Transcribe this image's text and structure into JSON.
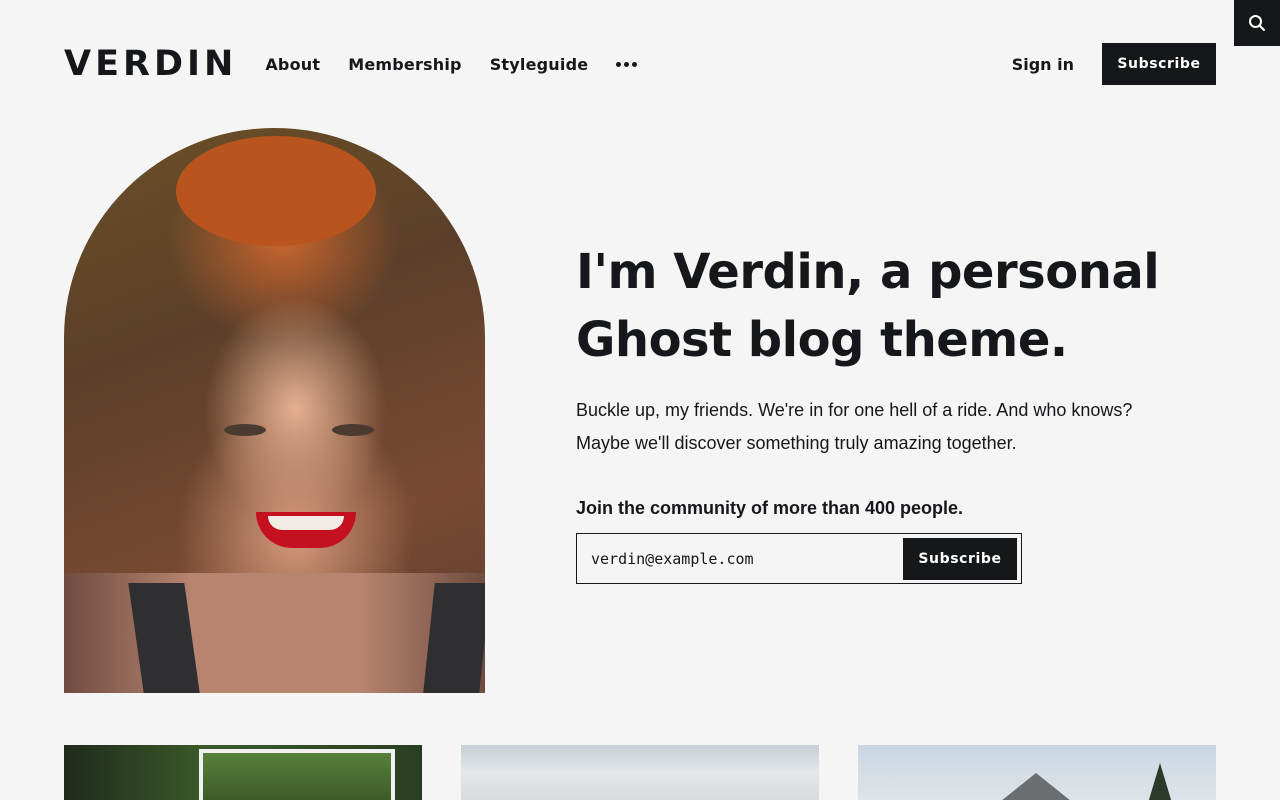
{
  "header": {
    "logo": "VERDIN",
    "nav": [
      {
        "label": "About"
      },
      {
        "label": "Membership"
      },
      {
        "label": "Styleguide"
      }
    ],
    "more_icon": "more-dots-icon",
    "signin_label": "Sign in",
    "subscribe_label": "Subscribe",
    "search_icon": "search-icon"
  },
  "hero": {
    "title": "I'm Verdin, a personal Ghost blog theme.",
    "description": "Buckle up, my friends. We're in for one hell of a ride. And who knows? Maybe we'll discover something truly amazing together.",
    "community_text": "Join the community of more than 400 people.",
    "email_value": "verdin@example.com",
    "form_button_label": "Subscribe"
  },
  "colors": {
    "background": "#f5f5f5",
    "text": "#15171a",
    "button": "#15171a",
    "button_text": "#ffffff"
  }
}
